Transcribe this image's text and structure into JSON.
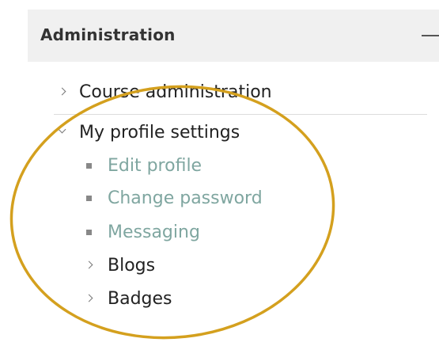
{
  "block": {
    "title": "Administration",
    "collapse_icon": "minus-icon"
  },
  "tree": {
    "course_admin": {
      "label": "Course administration",
      "icon": "chevron-right-icon"
    },
    "profile_settings": {
      "label": "My profile settings",
      "icon": "chevron-down-icon"
    },
    "children": [
      {
        "label": "Edit profile",
        "icon": "square-bullet-icon"
      },
      {
        "label": "Change password",
        "icon": "square-bullet-icon"
      },
      {
        "label": "Messaging",
        "icon": "square-bullet-icon"
      },
      {
        "label": "Blogs",
        "icon": "chevron-right-icon"
      },
      {
        "label": "Badges",
        "icon": "chevron-right-icon"
      }
    ]
  },
  "colors": {
    "header_background": "#f0f0f0",
    "link_text": "#7fa6a0",
    "annotation_circle": "#d4a01e"
  }
}
